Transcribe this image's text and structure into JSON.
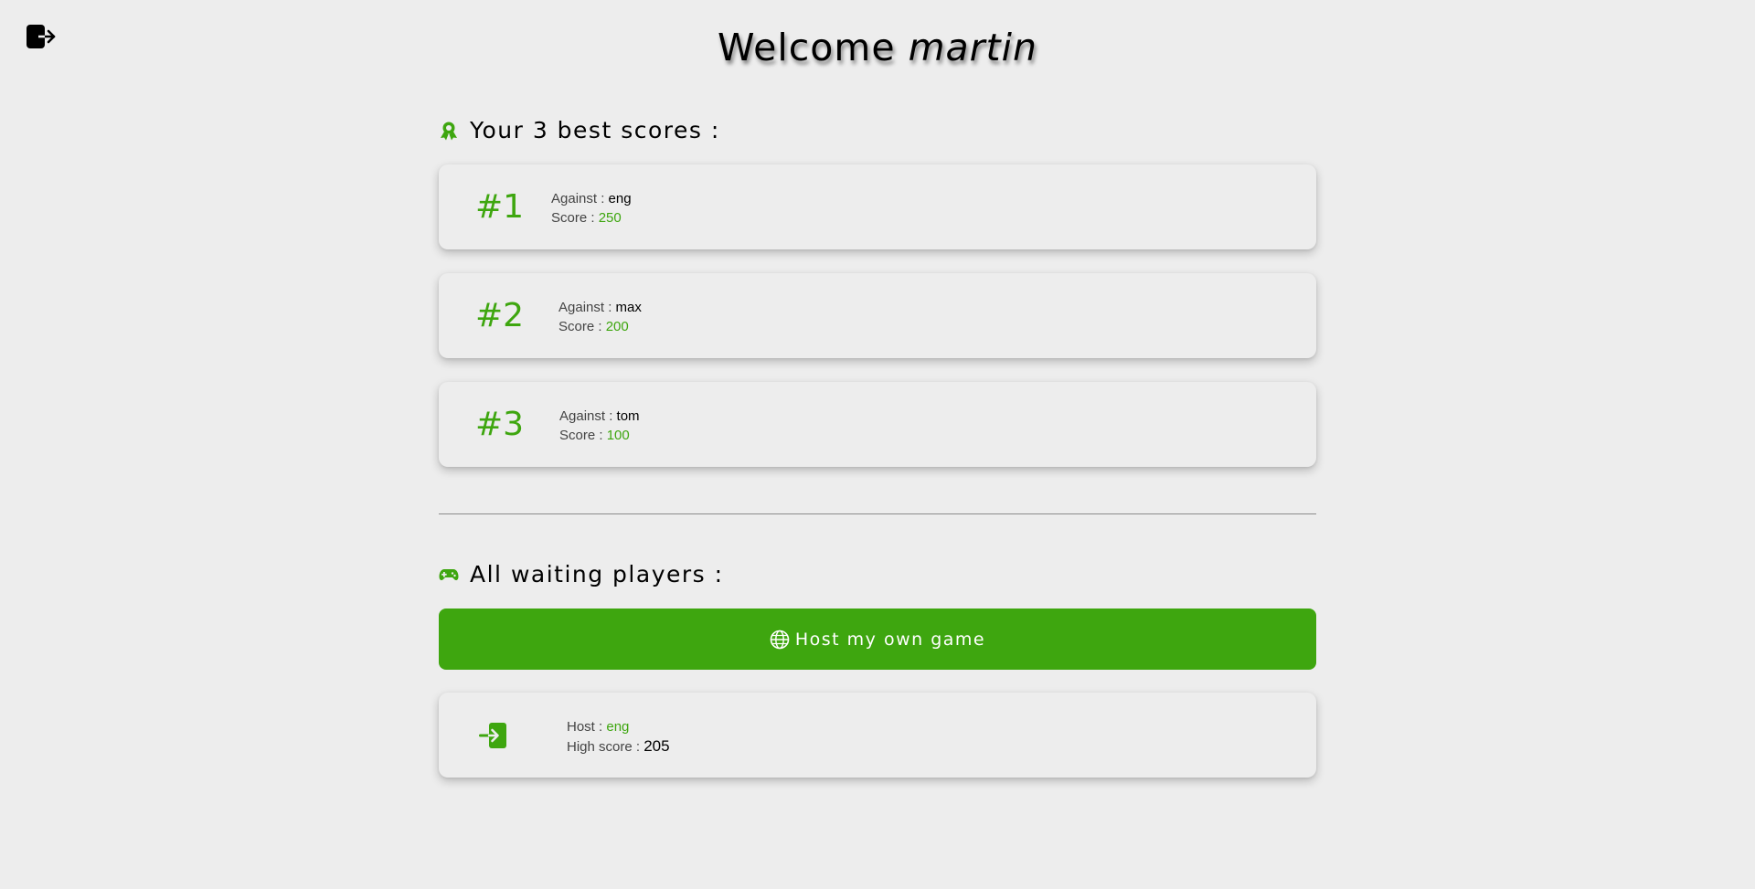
{
  "header": {
    "welcome": "Welcome",
    "username": "martin",
    "logout_icon": "logout-icon"
  },
  "best_scores": {
    "heading": "Your 3 best scores :",
    "icon": "award-icon",
    "against_label": "Against :",
    "score_label": "Score :",
    "items": [
      {
        "rank": "#1",
        "opponent": "eng",
        "score": "250"
      },
      {
        "rank": "#2",
        "opponent": "max",
        "score": "200"
      },
      {
        "rank": "#3",
        "opponent": "tom",
        "score": "100"
      }
    ]
  },
  "waiting": {
    "heading": "All waiting players :",
    "icon": "gamepad-icon",
    "host_button_label": "Host my own game",
    "host_button_icon": "globe-icon",
    "host_label": "Host :",
    "high_score_label": "High score :",
    "players": [
      {
        "host": "eng",
        "high_score": "205",
        "icon": "join-icon"
      }
    ]
  },
  "colors": {
    "accent": "#3ea60f",
    "background": "#ededed"
  }
}
